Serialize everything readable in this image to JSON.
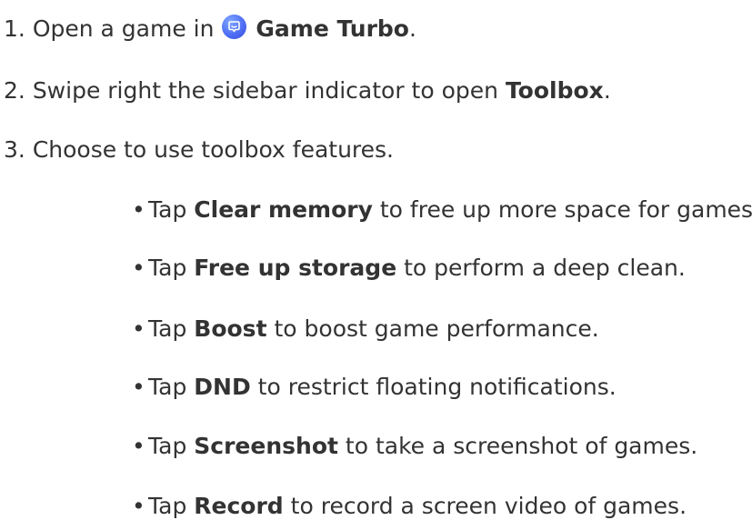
{
  "steps": [
    {
      "num": "1.",
      "before": "Open a game in",
      "bold": "Game Turbo",
      "after": "."
    },
    {
      "num": "2.",
      "before": "Swipe right the sidebar indicator to open",
      "bold": "Toolbox",
      "after": "."
    },
    {
      "num": "3.",
      "text": "Choose to use toolbox features."
    }
  ],
  "icons": {
    "game_turbo": "game-turbo-app-icon"
  },
  "bullet_char": "•",
  "bullets": [
    {
      "before": "Tap",
      "bold": "Clear memory",
      "after": "to free up more space for games."
    },
    {
      "before": "Tap",
      "bold": "Free up storage",
      "after": "to perform a deep clean."
    },
    {
      "before": "Tap",
      "bold": "Boost",
      "after": "to boost game performance."
    },
    {
      "before": "Tap",
      "bold": "DND",
      "after": "to restrict floating notifications."
    },
    {
      "before": "Tap",
      "bold": "Screenshot",
      "after": "to take a screenshot of games."
    },
    {
      "before": "Tap",
      "bold": "Record",
      "after": "to record a screen video of games."
    }
  ]
}
